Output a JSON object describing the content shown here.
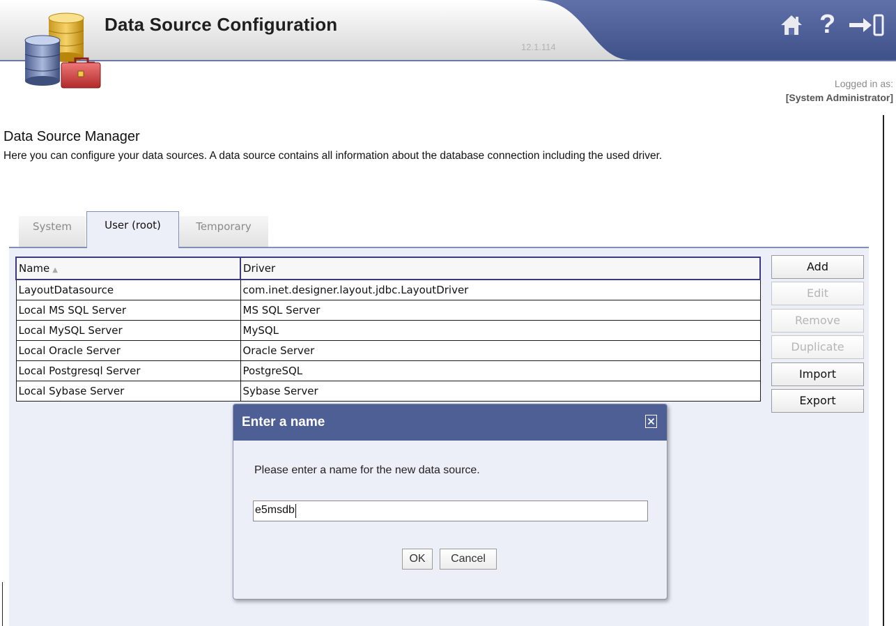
{
  "header": {
    "title": "Data Source Configuration",
    "version": "12.1.114",
    "icons": [
      "home-icon",
      "help-icon",
      "logout-icon"
    ],
    "help_glyph": "?"
  },
  "login": {
    "label": "Logged in as:",
    "user": "[System Administrator]"
  },
  "page": {
    "title": "Data Source Manager",
    "description": "Here you can configure your data sources. A data source contains all information about the database connection including the used driver."
  },
  "tabs": [
    {
      "label": "System",
      "active": false
    },
    {
      "label": "User (root)",
      "active": true
    },
    {
      "label": "Temporary",
      "active": false
    }
  ],
  "table": {
    "columns": [
      "Name",
      "Driver"
    ],
    "sort_glyph": "▲",
    "rows": [
      {
        "name": "LayoutDatasource",
        "driver": "com.inet.designer.layout.jdbc.LayoutDriver"
      },
      {
        "name": "Local MS SQL Server",
        "driver": "MS SQL Server"
      },
      {
        "name": "Local MySQL Server",
        "driver": "MySQL"
      },
      {
        "name": "Local Oracle Server",
        "driver": "Oracle Server"
      },
      {
        "name": "Local Postgresql Server",
        "driver": "PostgreSQL"
      },
      {
        "name": "Local Sybase Server",
        "driver": "Sybase Server"
      }
    ]
  },
  "actions": [
    {
      "label": "Add",
      "enabled": true
    },
    {
      "label": "Edit",
      "enabled": false
    },
    {
      "label": "Remove",
      "enabled": false
    },
    {
      "label": "Duplicate",
      "enabled": false
    },
    {
      "label": "Import",
      "enabled": true
    },
    {
      "label": "Export",
      "enabled": true
    }
  ],
  "dialog": {
    "title": "Enter a name",
    "message": "Please enter a name for the new data source.",
    "input_value": "e5msdb",
    "ok_label": "OK",
    "cancel_label": "Cancel"
  },
  "colors": {
    "header_band": "#4d5f95",
    "panel_bg": "#eceef8",
    "dialog_header": "#4d5f95"
  }
}
